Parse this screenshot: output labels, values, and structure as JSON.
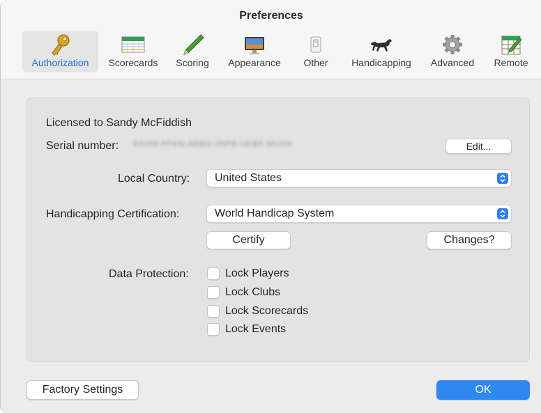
{
  "window": {
    "title": "Preferences"
  },
  "toolbar": {
    "items": [
      {
        "label": "Authorization",
        "icon": "key-icon",
        "selected": true
      },
      {
        "label": "Scorecards",
        "icon": "scorecard-icon",
        "selected": false
      },
      {
        "label": "Scoring",
        "icon": "pencil-icon",
        "selected": false
      },
      {
        "label": "Appearance",
        "icon": "monitor-icon",
        "selected": false
      },
      {
        "label": "Other",
        "icon": "switch-icon",
        "selected": false
      },
      {
        "label": "Handicapping",
        "icon": "horse-icon",
        "selected": false
      },
      {
        "label": "Advanced",
        "icon": "gear-icon",
        "selected": false
      },
      {
        "label": "Remote",
        "icon": "remote-scorecard-icon",
        "selected": false
      }
    ],
    "accent_color": "#1e6fd9"
  },
  "license": {
    "licensed_to": "Licensed to Sandy McFiddish",
    "serial_label": "Serial number:",
    "serial_value": "EXOM-FFKN-AEBU-JHPB-UEBF-MUXH",
    "edit_label": "Edit..."
  },
  "country": {
    "label": "Local Country:",
    "value": "United States"
  },
  "handicap": {
    "label": "Handicapping Certification:",
    "value": "World Handicap System",
    "certify_label": "Certify",
    "changes_label": "Changes?"
  },
  "protection": {
    "label": "Data Protection:",
    "options": [
      {
        "label": "Lock Players",
        "checked": false
      },
      {
        "label": "Lock Clubs",
        "checked": false
      },
      {
        "label": "Lock Scorecards",
        "checked": false
      },
      {
        "label": "Lock Events",
        "checked": false
      }
    ]
  },
  "footer": {
    "factory_label": "Factory Settings",
    "ok_label": "OK",
    "ok_color": "#2f87f0"
  }
}
